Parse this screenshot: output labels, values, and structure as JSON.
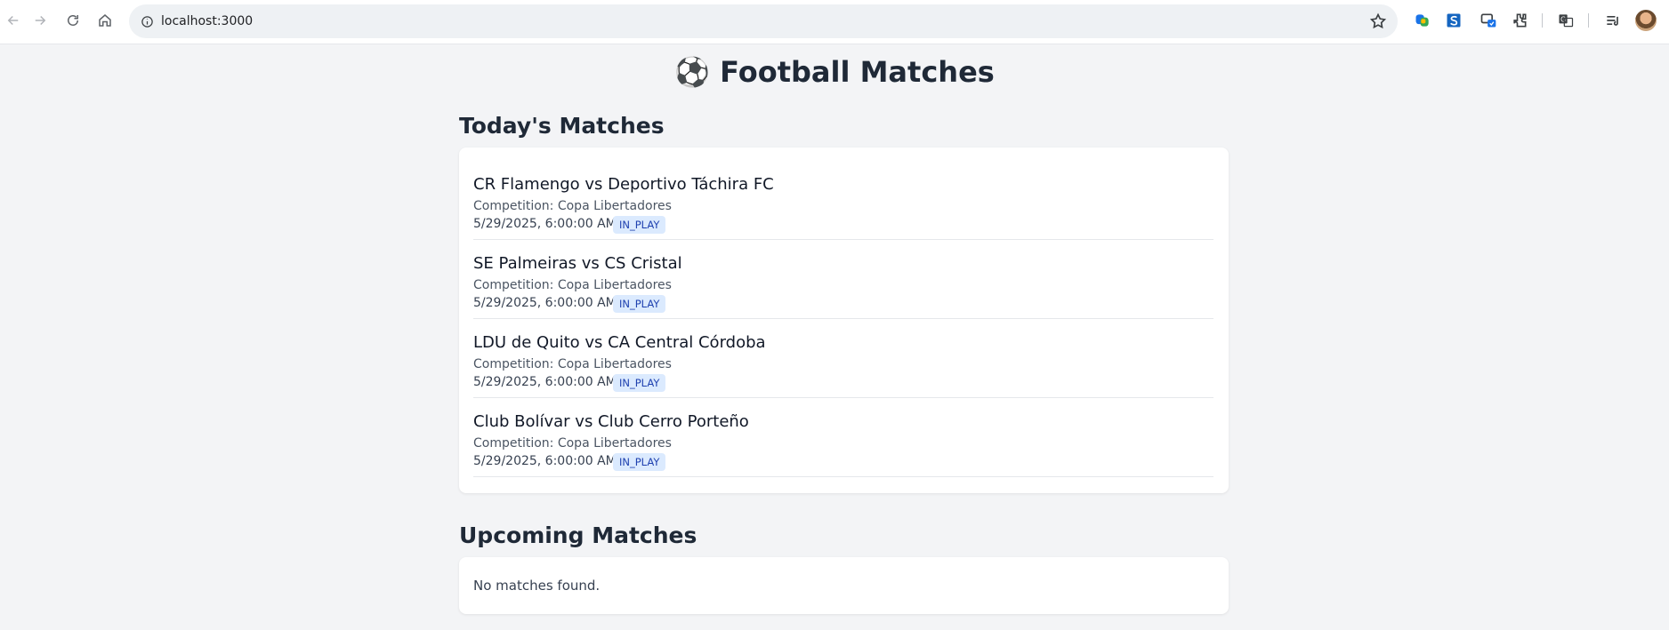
{
  "browser": {
    "url": "localhost:3000"
  },
  "page": {
    "title": "⚽ Football Matches"
  },
  "today": {
    "heading": "Today's Matches",
    "matches": [
      {
        "title": "CR Flamengo vs Deportivo Táchira FC",
        "competition": "Competition: Copa Libertadores",
        "datetime": "5/29/2025, 6:00:00 AM",
        "status": "IN_PLAY"
      },
      {
        "title": "SE Palmeiras vs CS Cristal",
        "competition": "Competition: Copa Libertadores",
        "datetime": "5/29/2025, 6:00:00 AM",
        "status": "IN_PLAY"
      },
      {
        "title": "LDU de Quito vs CA Central Córdoba",
        "competition": "Competition: Copa Libertadores",
        "datetime": "5/29/2025, 6:00:00 AM",
        "status": "IN_PLAY"
      },
      {
        "title": "Club Bolívar vs Club Cerro Porteño",
        "competition": "Competition: Copa Libertadores",
        "datetime": "5/29/2025, 6:00:00 AM",
        "status": "IN_PLAY"
      }
    ]
  },
  "upcoming": {
    "heading": "Upcoming Matches",
    "empty_text": "No matches found."
  },
  "colors": {
    "background": "#f3f4f6",
    "badge_bg": "#dbeafe",
    "badge_text": "#1e40af"
  }
}
